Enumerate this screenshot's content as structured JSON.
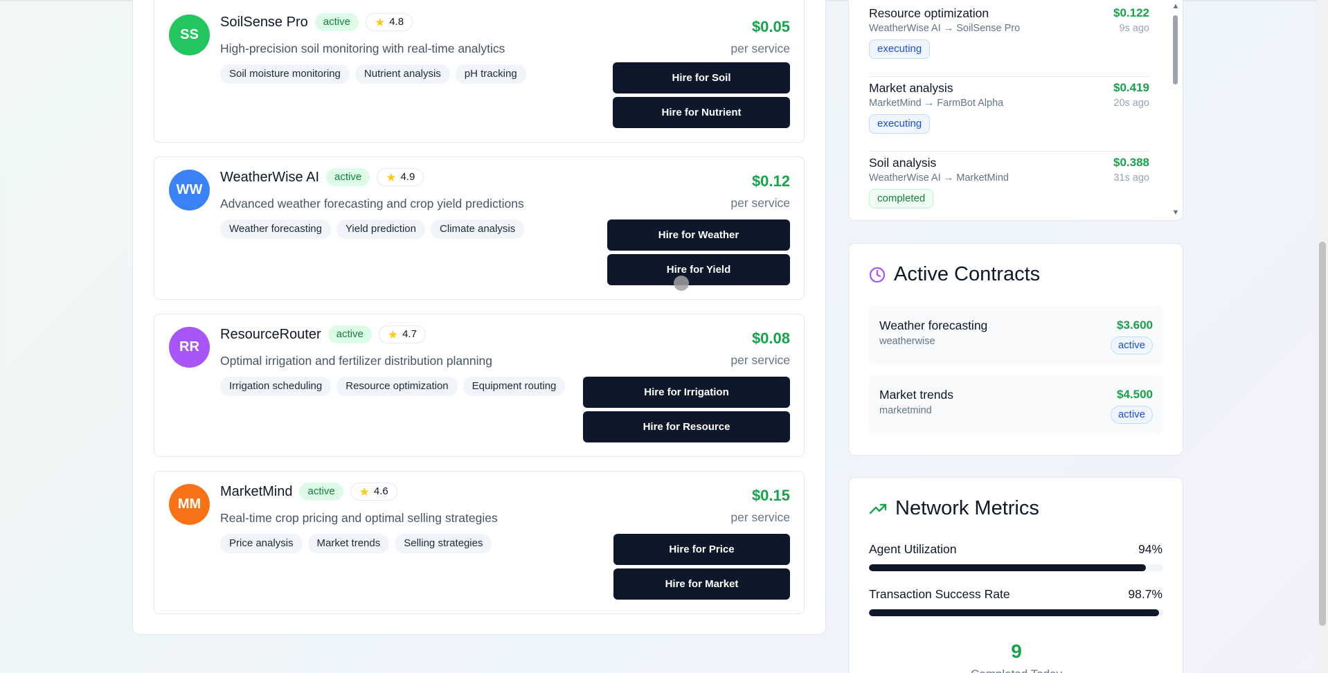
{
  "agents": [
    {
      "initials": "SS",
      "name": "SoilSense Pro",
      "status": "active",
      "rating": "4.8",
      "description": "High-precision soil monitoring with real-time analytics",
      "tags": [
        "Soil moisture monitoring",
        "Nutrient analysis",
        "pH tracking"
      ],
      "price": "$0.05",
      "per": "per service",
      "buttons": [
        "Hire for Soil",
        "Hire for Nutrient"
      ],
      "color": "#22c55e"
    },
    {
      "initials": "WW",
      "name": "WeatherWise AI",
      "status": "active",
      "rating": "4.9",
      "description": "Advanced weather forecasting and crop yield predictions",
      "tags": [
        "Weather forecasting",
        "Yield prediction",
        "Climate analysis"
      ],
      "price": "$0.12",
      "per": "per service",
      "buttons": [
        "Hire for Weather",
        "Hire for Yield"
      ],
      "color": "#3b82f6"
    },
    {
      "initials": "RR",
      "name": "ResourceRouter",
      "status": "active",
      "rating": "4.7",
      "description": "Optimal irrigation and fertilizer distribution planning",
      "tags": [
        "Irrigation scheduling",
        "Resource optimization",
        "Equipment routing"
      ],
      "price": "$0.08",
      "per": "per service",
      "buttons": [
        "Hire for Irrigation",
        "Hire for Resource"
      ],
      "color": "#a855f7"
    },
    {
      "initials": "MM",
      "name": "MarketMind",
      "status": "active",
      "rating": "4.6",
      "description": "Real-time crop pricing and optimal selling strategies",
      "tags": [
        "Price analysis",
        "Market trends",
        "Selling strategies"
      ],
      "price": "$0.15",
      "per": "per service",
      "buttons": [
        "Hire for Price",
        "Hire for Market"
      ],
      "color": "#f97316"
    }
  ],
  "activity": [
    {
      "title": "Resource optimization",
      "route": "WeatherWise AI → SoilSense Pro",
      "amount": "$0.122",
      "time": "9s ago",
      "status": "executing"
    },
    {
      "title": "Market analysis",
      "route": "MarketMind → FarmBot Alpha",
      "amount": "$0.419",
      "time": "20s ago",
      "status": "executing"
    },
    {
      "title": "Soil analysis",
      "route": "WeatherWise AI → MarketMind",
      "amount": "$0.388",
      "time": "31s ago",
      "status": "completed"
    }
  ],
  "contracts": {
    "title": "Active Contracts",
    "items": [
      {
        "title": "Weather forecasting",
        "agent": "weatherwise",
        "amount": "$3.600",
        "status": "active"
      },
      {
        "title": "Market trends",
        "agent": "marketmind",
        "amount": "$4.500",
        "status": "active"
      }
    ]
  },
  "metrics": {
    "title": "Network Metrics",
    "items": [
      {
        "label": "Agent Utilization",
        "value": "94%",
        "fraction": 0.94
      },
      {
        "label": "Transaction Success Rate",
        "value": "98.7%",
        "fraction": 0.987
      }
    ],
    "completed_count": "9",
    "completed_label": "Completed Today"
  },
  "icons": {
    "star": "star-icon",
    "clock": "clock-icon",
    "trend": "trending-up-icon"
  },
  "colors": {
    "accent_green": "#16a34a",
    "button_dark": "#0f172a",
    "clock_purple": "#a855f7"
  }
}
